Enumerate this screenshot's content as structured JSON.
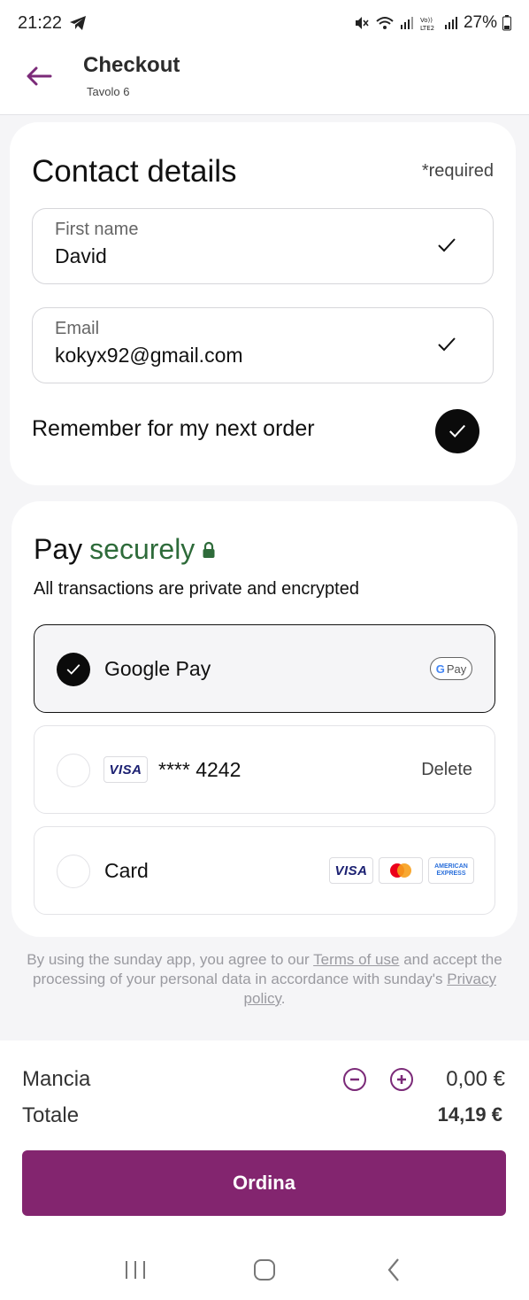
{
  "status_bar": {
    "time": "21:22",
    "battery": "27%",
    "icons": [
      "telegram-icon",
      "mute-icon",
      "wifi-icon",
      "signal-icon",
      "volte-icon",
      "signal-icon",
      "battery-icon"
    ]
  },
  "header": {
    "title": "Checkout",
    "subtitle": "Tavolo 6",
    "back_icon": "arrow-left-icon"
  },
  "contact": {
    "title": "Contact details",
    "required_note": "*required",
    "first_name": {
      "label": "First name",
      "value": "David"
    },
    "email": {
      "label": "Email",
      "value": "kokyx92@gmail.com"
    },
    "remember_label": "Remember for my next order",
    "remember_checked": true
  },
  "payment": {
    "title_prefix": "Pay",
    "title_secure": "securely",
    "subtitle": "All transactions are private and encrypted",
    "options": [
      {
        "label": "Google Pay",
        "selected": true,
        "badge": "G Pay"
      },
      {
        "brand": "VISA",
        "number": "**** 4242",
        "action": "Delete",
        "selected": false
      },
      {
        "label": "Card",
        "selected": false,
        "brands": [
          "VISA",
          "Mastercard",
          "AMERICAN EXPRESS"
        ]
      }
    ]
  },
  "terms": {
    "before": "By using the sunday app, you agree to our",
    "terms_link": "Terms of use",
    "middle": "and accept the processing of your personal data in accordance with sunday's",
    "privacy_link": "Privacy policy",
    "after": "."
  },
  "summary": {
    "tip_label": "Mancia",
    "tip_value": "0,00 €",
    "total_label": "Totale",
    "total_value": "14,19 €",
    "order_button": "Ordina"
  },
  "colors": {
    "accent": "#83256f",
    "secure_green": "#2e6b3a",
    "dark": "#0b0b0b"
  }
}
